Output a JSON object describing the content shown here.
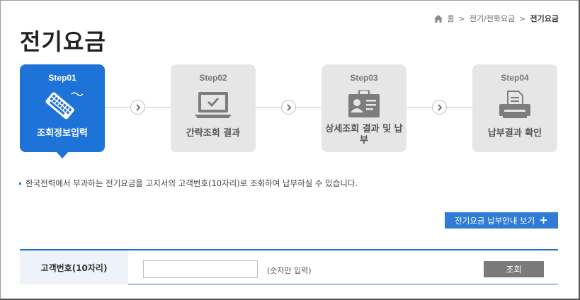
{
  "breadcrumb": {
    "home_icon": "home-icon",
    "items": [
      "홈",
      "전기/전화요금",
      "전기요금"
    ],
    "separator": ">"
  },
  "page_title": "전기요금",
  "steps": [
    {
      "step_no": "Step01",
      "label": "조회정보입력",
      "icon": "keyboard-icon",
      "active": true
    },
    {
      "step_no": "Step02",
      "label": "간략조회 결과",
      "icon": "monitor-check-icon",
      "active": false
    },
    {
      "step_no": "Step03",
      "label": "상세조회 결과 및 납부",
      "icon": "id-card-icon",
      "active": false
    },
    {
      "step_no": "Step04",
      "label": "납부결과 확인",
      "icon": "printer-icon",
      "active": false
    }
  ],
  "step_arrow_icon": "chevron-right-icon",
  "notice": "한국전력에서 부과하는 전기요금을 고지서의 고객번호(10자리)로 조회하여 납부하실 수 있습니다.",
  "guide_button": {
    "label": "전기요금 납부안내 보기",
    "icon": "plus-icon",
    "icon_glyph": "+"
  },
  "search_form": {
    "field_label": "고객번호(10자리)",
    "input_value": "",
    "hint": "(숫자만 입력)",
    "submit_label": "조회"
  },
  "colors": {
    "accent": "#1e73d9",
    "inactive_step": "#e6e6e6",
    "submit_button": "#7a7a7a"
  }
}
